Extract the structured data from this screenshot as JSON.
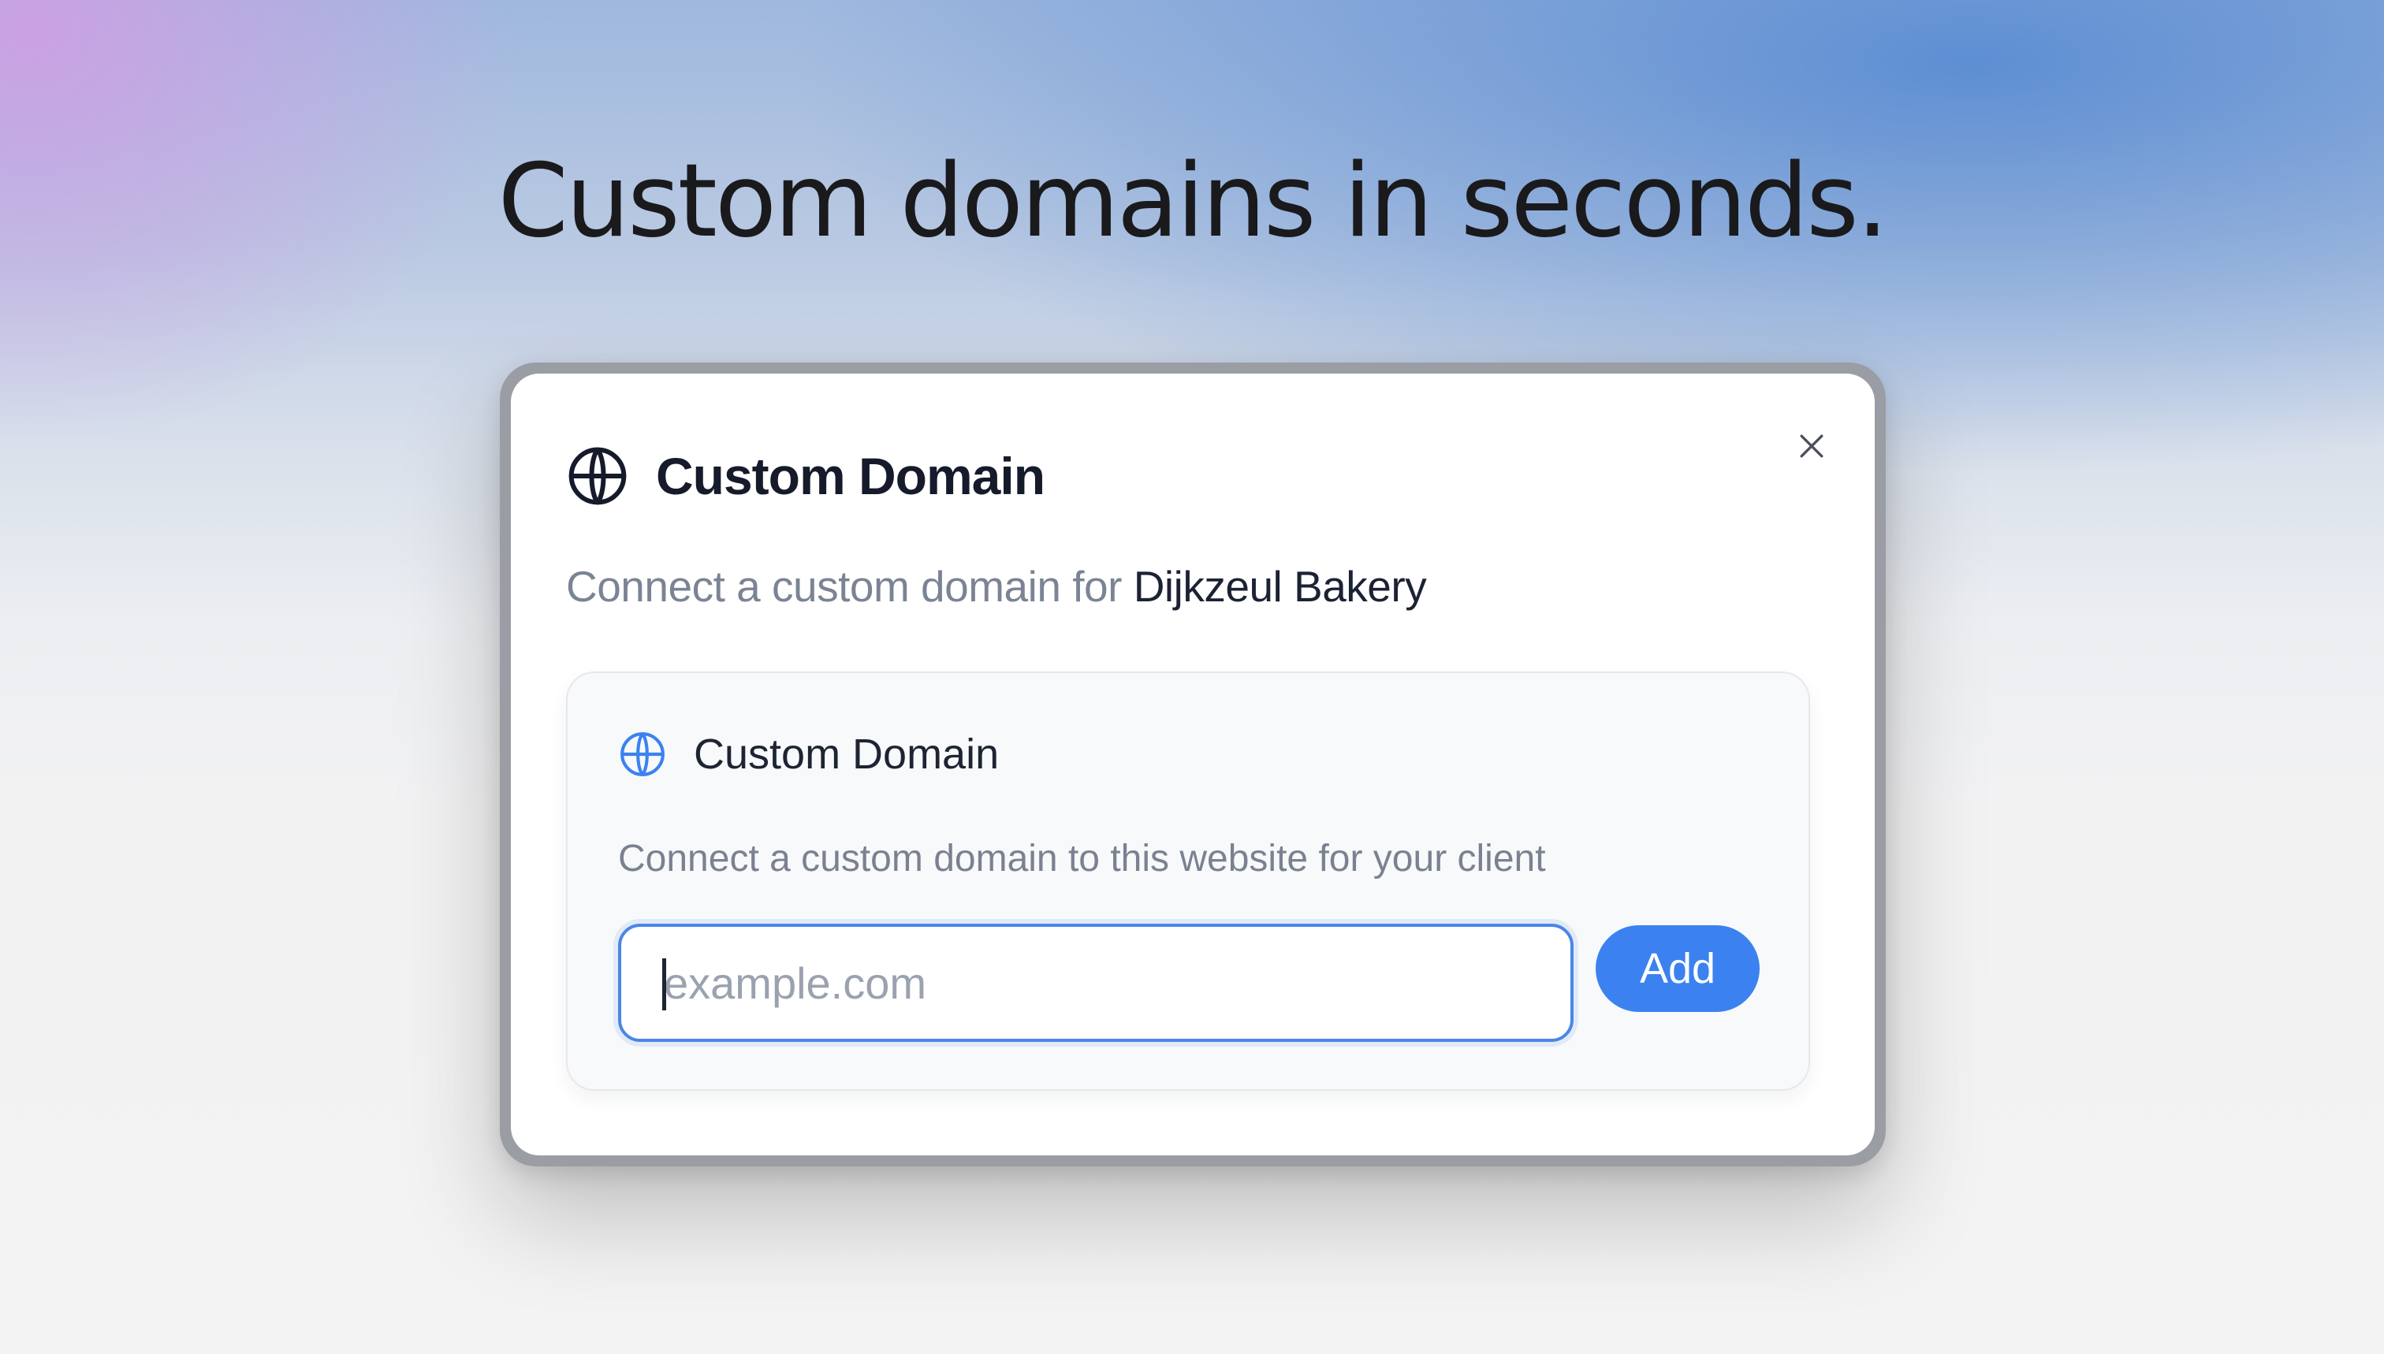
{
  "headline": "Custom domains in seconds.",
  "modal": {
    "title": "Custom Domain",
    "title_icon": "globe-icon",
    "close_icon": "close-icon",
    "subtitle_prefix": "Connect a custom domain for ",
    "client_name": "Dijkzeul Bakery"
  },
  "card": {
    "title": "Custom Domain",
    "title_icon": "globe-icon",
    "description": "Connect a custom domain to this website for your client",
    "input": {
      "value": "",
      "placeholder": "example.com"
    },
    "add_label": "Add"
  },
  "colors": {
    "accent": "#3b82f0",
    "input_border": "#4a86e8",
    "title_text": "#151b2b",
    "muted_text": "#7b8494"
  }
}
